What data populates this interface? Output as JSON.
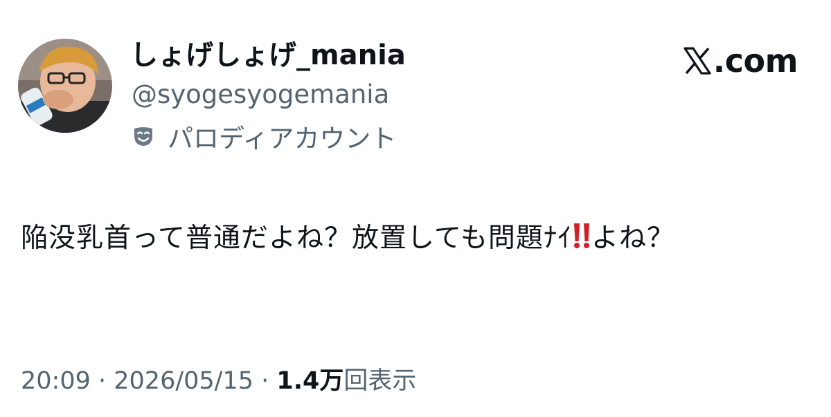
{
  "author": {
    "display_name": "しょげしょげ_mania",
    "handle": "@syogesyogemania",
    "label": "パロディアカウント",
    "label_icon": "parody-mask-icon",
    "avatar_icon": "user-avatar"
  },
  "brand": {
    "text": ".com",
    "logo": "x-logo-icon"
  },
  "tweet": {
    "text_part1": "陥没乳首って普通だよね？放置しても問題ﾅｲ",
    "emoji": "double-exclamation-mark",
    "text_part2": "よね？"
  },
  "meta": {
    "time": "20:09",
    "separator1": " · ",
    "date": "2026/05/15",
    "separator2": " · ",
    "views_count": "1.4万",
    "views_label": "回表示"
  },
  "colors": {
    "text_primary": "#0f1419",
    "text_secondary": "#536471",
    "emoji_red": "#d0202a"
  }
}
